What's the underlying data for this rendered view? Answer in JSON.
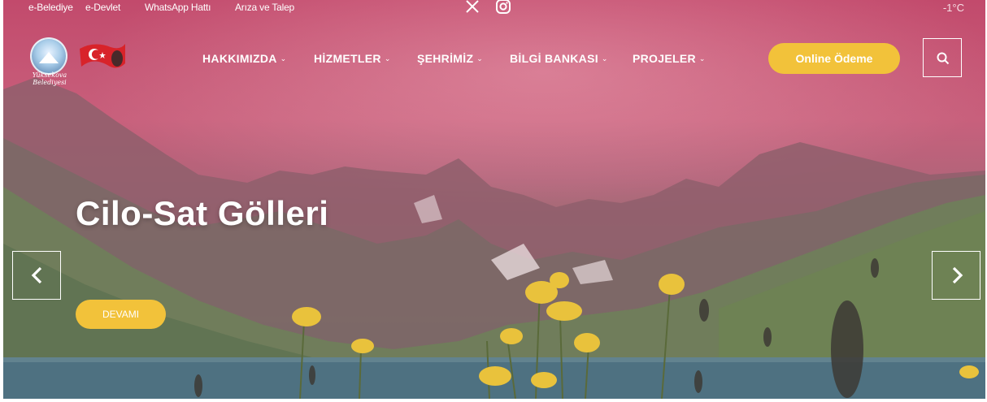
{
  "topbar": {
    "links": [
      "e-Belediye",
      "e-Devlet",
      "WhatsApp Hattı",
      "Arıza ve Talep"
    ],
    "social": {
      "x_icon": "x-icon",
      "instagram_icon": "instagram-icon"
    },
    "temperature": "-1°C"
  },
  "logo": {
    "badge_text": "Yüksekova Belediyesi"
  },
  "nav": {
    "items": [
      "HAKKIMIZDA",
      "HİZMETLER",
      "ŞEHRİMİZ",
      "BİLGİ BANKASI",
      "PROJELER"
    ]
  },
  "actions": {
    "online_payment": "Online Ödeme"
  },
  "slider": {
    "title": "Cilo-Sat Gölleri",
    "more_label": "DEVAMI"
  },
  "colors": {
    "accent": "#f2c23a",
    "overlay": "#c24a6c"
  }
}
